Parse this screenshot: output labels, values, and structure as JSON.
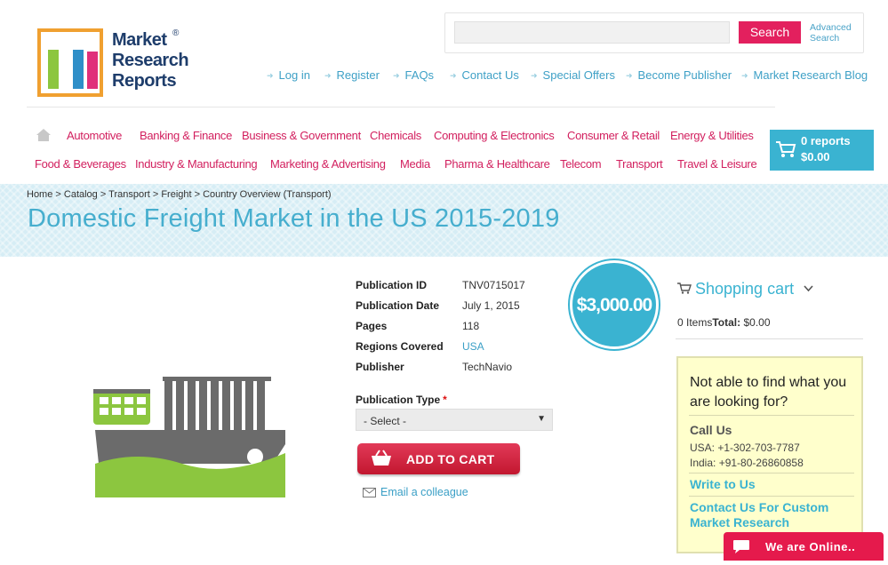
{
  "logo": {
    "line1": "Market",
    "line2": "Research",
    "line3": "Reports",
    "reg": "®"
  },
  "search": {
    "placeholder": "",
    "button_label": "Search",
    "advanced_line1": "Advanced",
    "advanced_line2": "Search"
  },
  "top_nav": [
    "Log in",
    "Register",
    "FAQs",
    "Contact Us",
    "Special Offers",
    "Become Publisher",
    "Market Research Blog"
  ],
  "categories_row1": [
    "Automotive",
    "Banking & Finance",
    "Business & Government",
    "Chemicals",
    "Computing & Electronics",
    "Consumer & Retail",
    "Energy & Utilities"
  ],
  "categories_row2": [
    "Food & Beverages",
    "Industry & Manufacturing",
    "Marketing & Advertising",
    "Media",
    "Pharma & Healthcare",
    "Telecom",
    "Transport",
    "Travel & Leisure"
  ],
  "header_cart": {
    "reports": "0 reports",
    "total": "$0.00"
  },
  "breadcrumb": "Home > Catalog > Transport > Freight > Country Overview (Transport)",
  "page_title": "Domestic Freight Market in the US 2015-2019",
  "product": {
    "labels": {
      "id": "Publication ID",
      "date": "Publication Date",
      "pages": "Pages",
      "regions": "Regions Covered",
      "publisher": "Publisher"
    },
    "values": {
      "id": "TNV0715017",
      "date": "July 1, 2015",
      "pages": "118",
      "regions": "USA",
      "publisher": "TechNavio"
    },
    "price": "$3,000.00",
    "type_label": "Publication Type",
    "required_mark": "*",
    "type_selected": "- Select -",
    "add_to_cart": "ADD TO CART",
    "email_colleague": "Email a colleague"
  },
  "sidebar": {
    "cart_title": "Shopping cart",
    "cart_items": "0 Items",
    "cart_total_label": "Total:",
    "cart_total_value": "$0.00",
    "help_question": "Not able to find what you are looking for?",
    "call_us": "Call Us",
    "phone_usa": "USA: +1-302-703-7787",
    "phone_india": "India: +91-80-26860858",
    "write_to_us": "Write to Us",
    "contact_custom": "Contact Us For Custom Market Research"
  },
  "chat": {
    "label": "We are Online.."
  },
  "colors": {
    "accent_blue": "#3ab3d1",
    "accent_pink": "#e3205e",
    "category_text": "#d21f5e",
    "banner_bg": "#d6edf5",
    "help_bg": "#ffffcc"
  },
  "icons": [
    "home-icon",
    "cart-icon",
    "chevron-down-icon",
    "email-icon",
    "chat-icon",
    "ship-icon"
  ]
}
